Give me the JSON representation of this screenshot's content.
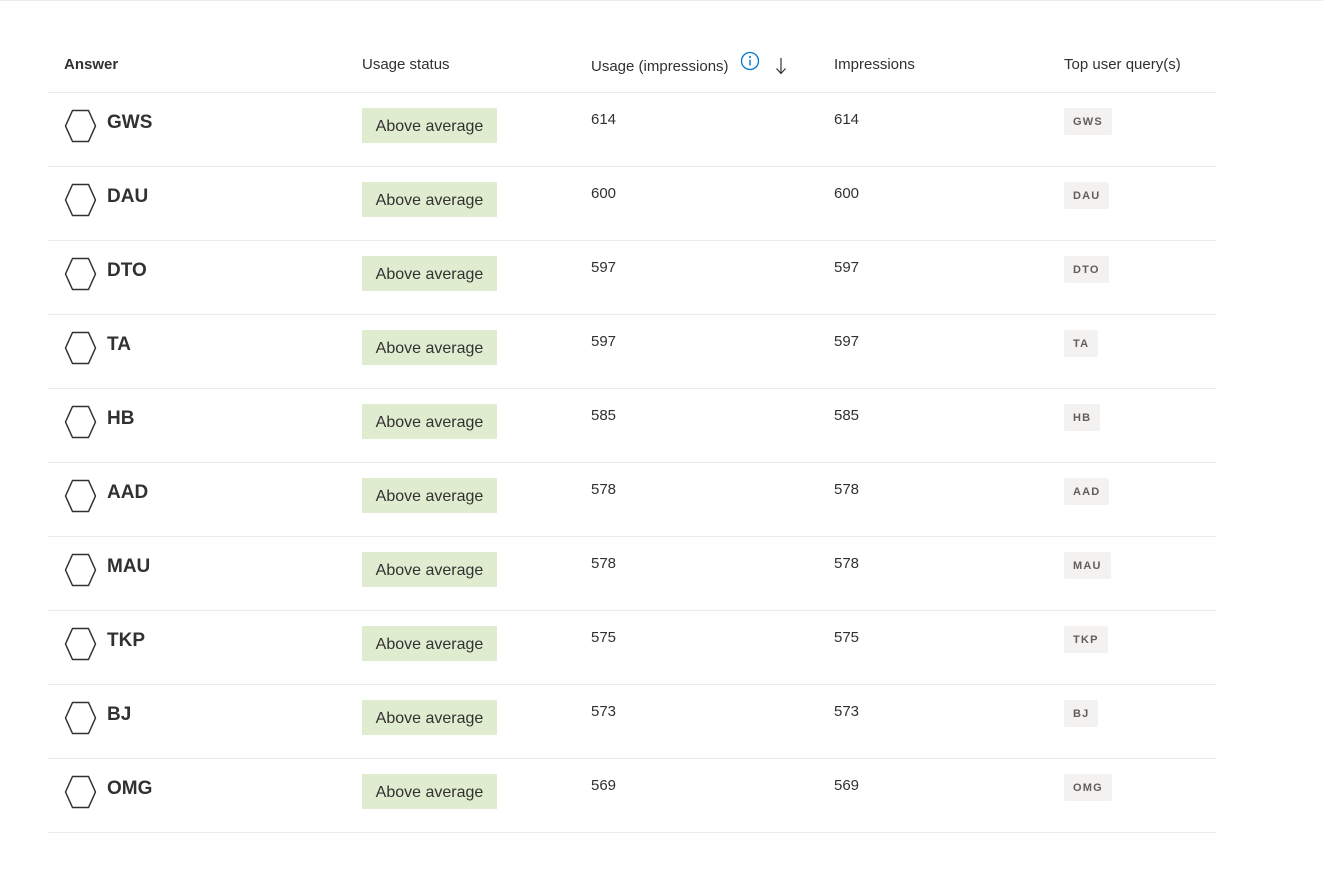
{
  "columns": {
    "answer": "Answer",
    "usage_status": "Usage status",
    "usage_impressions": "Usage (impressions)",
    "impressions": "Impressions",
    "top_queries": "Top user query(s)"
  },
  "icons": {
    "answer_icon": "hexagon-icon",
    "info_icon": "info-icon",
    "sort_icon": "arrow-down-icon"
  },
  "colors": {
    "status_badge_bg": "#dfecd0",
    "info_icon": "#0078d4",
    "query_tag_bg": "#f3f2f1"
  },
  "rows": [
    {
      "answer": "GWS",
      "status": "Above average",
      "usage": "614",
      "impressions": "614",
      "query": "GWS"
    },
    {
      "answer": "DAU",
      "status": "Above average",
      "usage": "600",
      "impressions": "600",
      "query": "DAU"
    },
    {
      "answer": "DTO",
      "status": "Above average",
      "usage": "597",
      "impressions": "597",
      "query": "DTO"
    },
    {
      "answer": "TA",
      "status": "Above average",
      "usage": "597",
      "impressions": "597",
      "query": "TA"
    },
    {
      "answer": "HB",
      "status": "Above average",
      "usage": "585",
      "impressions": "585",
      "query": "HB"
    },
    {
      "answer": "AAD",
      "status": "Above average",
      "usage": "578",
      "impressions": "578",
      "query": "AAD"
    },
    {
      "answer": "MAU",
      "status": "Above average",
      "usage": "578",
      "impressions": "578",
      "query": "MAU"
    },
    {
      "answer": "TKP",
      "status": "Above average",
      "usage": "575",
      "impressions": "575",
      "query": "TKP"
    },
    {
      "answer": "BJ",
      "status": "Above average",
      "usage": "573",
      "impressions": "573",
      "query": "BJ"
    },
    {
      "answer": "OMG",
      "status": "Above average",
      "usage": "569",
      "impressions": "569",
      "query": "OMG"
    }
  ]
}
